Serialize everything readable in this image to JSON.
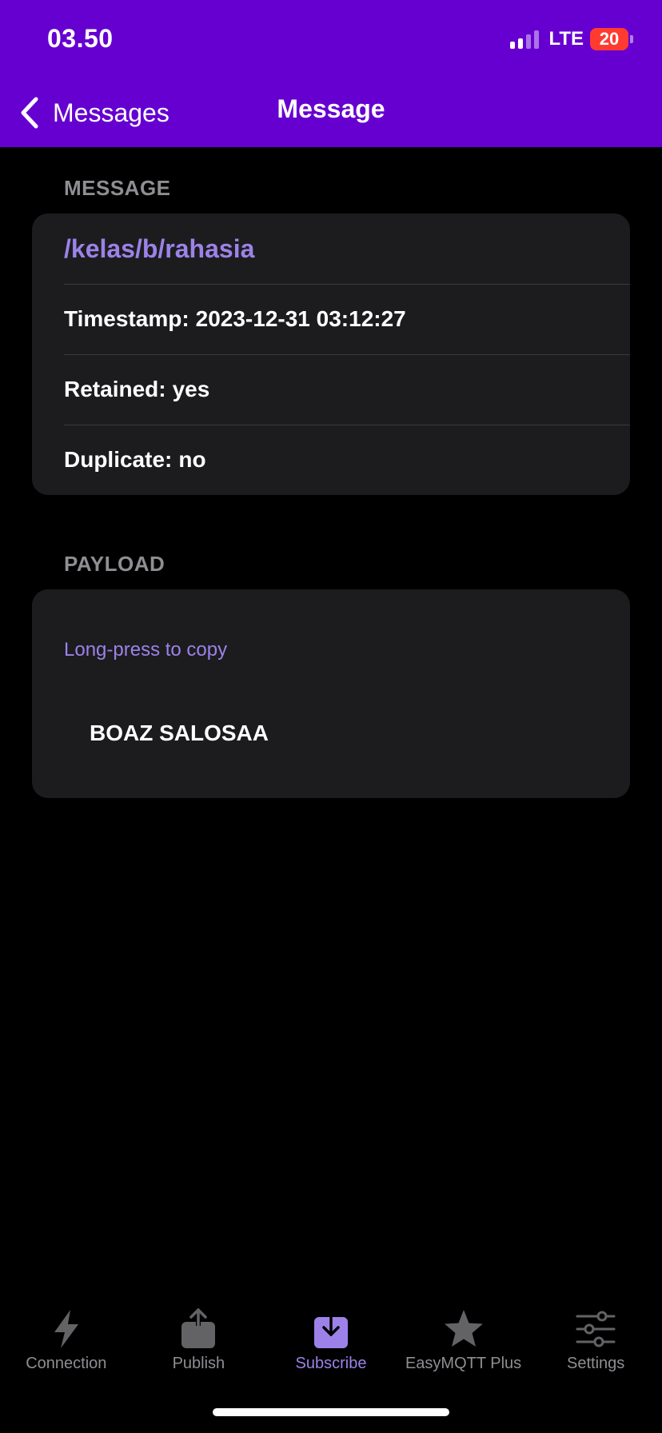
{
  "status_bar": {
    "time": "03.50",
    "network": "LTE",
    "battery": "20"
  },
  "nav": {
    "back_label": "Messages",
    "title": "Message"
  },
  "message_section": {
    "header": "MESSAGE",
    "topic": "/kelas/b/rahasia",
    "timestamp_label": "Timestamp:",
    "timestamp_value": "2023-12-31 03:12:27",
    "retained_label": "Retained:",
    "retained_value": "yes",
    "duplicate_label": "Duplicate:",
    "duplicate_value": "no"
  },
  "payload_section": {
    "header": "PAYLOAD",
    "hint": "Long-press to copy",
    "content": "BOAZ SALOSAA"
  },
  "tabs": [
    {
      "label": "Connection",
      "icon": "bolt-icon",
      "active": false
    },
    {
      "label": "Publish",
      "icon": "upload-icon",
      "active": false
    },
    {
      "label": "Subscribe",
      "icon": "download-icon",
      "active": true
    },
    {
      "label": "EasyMQTT Plus",
      "icon": "star-icon",
      "active": false
    },
    {
      "label": "Settings",
      "icon": "sliders-icon",
      "active": false
    }
  ],
  "colors": {
    "header": "#6600D1",
    "accent": "#9C82E8",
    "card": "#1C1C1E",
    "inactive": "#8E8E93"
  }
}
